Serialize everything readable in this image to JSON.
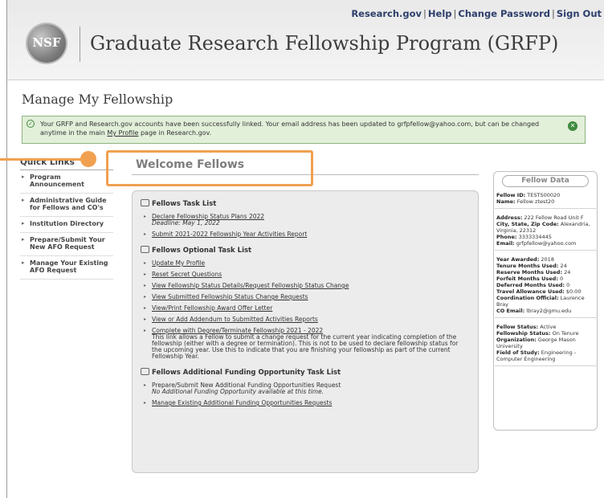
{
  "header": {
    "links": [
      "Research.gov",
      "Help",
      "Change Password",
      "Sign Out"
    ],
    "logo_text": "NSF",
    "app_title": "Graduate Research Fellowship Program (GRFP)"
  },
  "page_title": "Manage My Fellowship",
  "alert": {
    "text_before": "Your GRFP and Research.gov accounts have been successfully linked. Your email address has been updated to grfpfellow@yahoo.com, but can be changed anytime in the main ",
    "link": "My Profile",
    "text_after": " page in Research.gov.",
    "colors": {
      "background": "#e2efd9",
      "border": "#8db47d",
      "icon": "#3e8a3e"
    }
  },
  "quick_links": {
    "title": "Quick Links",
    "items": [
      "Program Announcement",
      "Administrative Guide for Fellows and CO's",
      "Institution Directory",
      "Prepare/Submit Your New AFO Request",
      "Manage Your Existing AFO Request"
    ]
  },
  "welcome": "Welcome Fellows",
  "highlight_color": "#f0a050",
  "task_list": {
    "title": "Fellows Task List",
    "items": [
      {
        "link": "Declare Fellowship Status Plans 2022",
        "note": "Deadline: May 1, 2022"
      },
      {
        "link": "Submit 2021-2022 Fellowship Year Activities Report"
      }
    ]
  },
  "optional_list": {
    "title": "Fellows Optional Task List",
    "items": [
      "Update My Profile",
      "Reset Secret Questions",
      "View Fellowship Status Details/Request Fellowship Status Change",
      "View Submitted Fellowship Status Change Requests",
      "View/Print Fellowship Award Offer Letter",
      "View or Add Addendum to Submitted Activities Reports",
      "Complete with Degree/Terminate Fellowship 2021 - 2022"
    ],
    "last_item_desc": "This link allows a Fellow to submit a change request for the current year indicating completion of the fellowship (either with a degree or termination). This is not to be used to declare fellowship status for the upcoming year. Use this to indicate that you are finishing your fellowship as part of the current Fellowship Year."
  },
  "funding_list": {
    "title": "Fellows Additional Funding Opportunity Task List",
    "item1": "Prepare/Submit New Additional Funding Opportunities Request",
    "item1_note": "No Additional Funding Opportunity available at this time.",
    "item2": "Manage Existing Additional Funding Opportunities Requests"
  },
  "fellow_data": {
    "title": "Fellow Data",
    "fellow_id_label": "Fellow ID:",
    "fellow_id": "TESTS00020",
    "name_label": "Name:",
    "name": "Fellow ztest20",
    "address_label": "Address:",
    "address": "222 Fellow Road Unit F",
    "csz_label": "City, State, Zip Code:",
    "csz": "Alexandria, Virginia, 22312",
    "phone_label": "Phone:",
    "phone": "3333334445",
    "email_label": "Email:",
    "email": "grfpfellow@yahoo.com",
    "year_label": "Year Awarded:",
    "year": "2018",
    "tenure_label": "Tenure Months Used:",
    "tenure": "24",
    "reserve_label": "Reserve Months Used:",
    "reserve": "24",
    "forfeit_label": "Forfeit Months Used:",
    "forfeit": "0",
    "deferred_label": "Deferred Months Used:",
    "deferred": "0",
    "travel_label": "Travel Allowance Used:",
    "travel": "$0.00",
    "coord_label": "Coordination Official:",
    "coord": "Laurence Bray",
    "coemail_label": "CO Email:",
    "coemail": "lbray2@gmu.edu",
    "status_label": "Fellow Status:",
    "status": "Active",
    "fstatus_label": "Fellowship Status:",
    "fstatus": "On Tenure",
    "org_label": "Organization:",
    "org": "George Mason University",
    "field_label": "Field of Study:",
    "field": "Engineering - Computer Engineering"
  }
}
